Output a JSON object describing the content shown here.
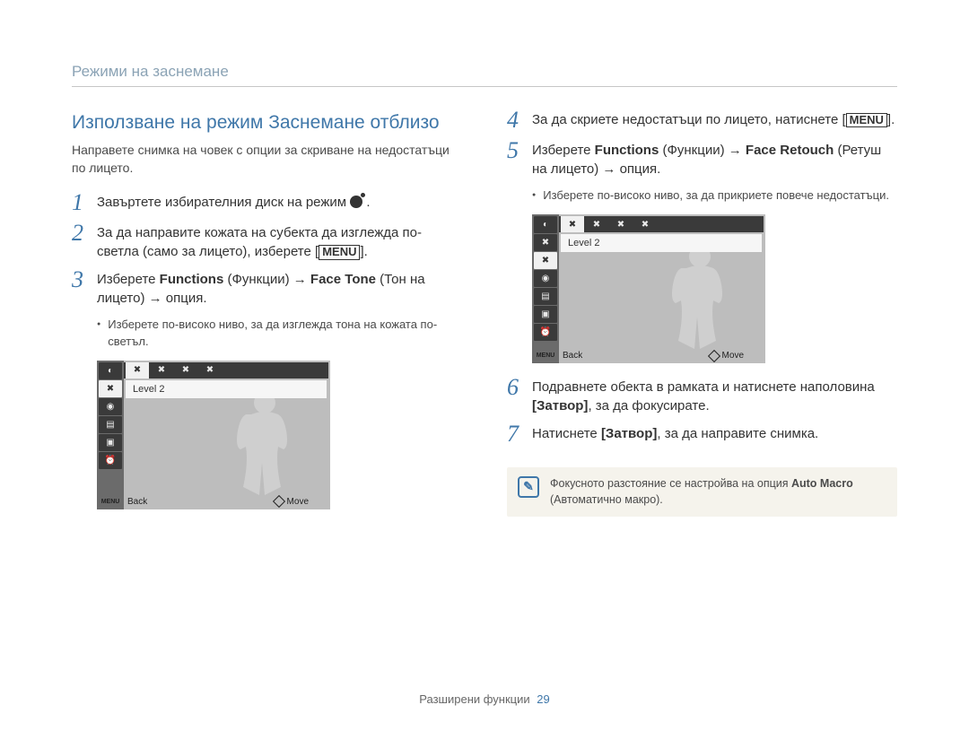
{
  "section_title": "Режими на заснемане",
  "heading": "Използване на режим Заснемане отблизо",
  "intro": "Направете снимка на човек с опции за скриване на недостатъци по лицето.",
  "steps_left": {
    "s1": "Завъртете избирателния диск на режим ",
    "s2_a": "За да направите кожата на субекта да изглежда по-светла (само за лицето), изберете ",
    "s2_b": "[",
    "menu_label": "MENU",
    "s2_c": "].",
    "s3_a": "Изберете ",
    "s3_b": "Functions",
    "s3_c": " (Функции) → ",
    "s3_d": "Face Tone",
    "s3_e": " (Тон на лицето) → опция.",
    "s3_bullet": "Изберете по-високо ниво, за да изглежда тона на кожата по-светъл."
  },
  "steps_right": {
    "s4_a": "За да скриете недостатъци по лицето, натиснете ",
    "s4_b": "[",
    "menu_label": "MENU",
    "s4_c": "].",
    "s5_a": "Изберете ",
    "s5_b": "Functions",
    "s5_c": " (Функции) → ",
    "s5_d": "Face Retouch",
    "s5_e": " (Ретуш на лицето) → опция.",
    "s5_bullet": "Изберете по-високо ниво, за да прикриете повече недостатъци.",
    "s6_a": "Подравнете обекта в рамката и натиснете наполовина ",
    "s6_b": "[Затвор]",
    "s6_c": ", за да фокусирате.",
    "s7_a": "Натиснете ",
    "s7_b": "[Затвор]",
    "s7_c": ", за да направите снимка."
  },
  "note": {
    "line1a": "Фокусното разстояние се настройва на опция ",
    "line1b": "Auto Macro",
    "line2": " (Автоматично макро)."
  },
  "screen": {
    "level": "Level 2",
    "menu": "MENU",
    "back": "Back",
    "move": "Move",
    "side_icons": [
      "◐",
      "✖",
      "◉",
      "▤",
      "▣",
      "⏰"
    ],
    "top_icons": [
      "✖",
      "✖",
      "✖",
      "✖"
    ]
  },
  "footer": {
    "label": "Разширени функции",
    "page": "29"
  }
}
